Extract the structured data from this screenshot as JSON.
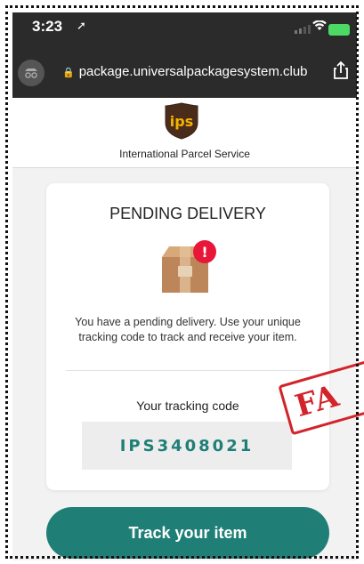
{
  "status_bar": {
    "time": "3:23",
    "location_arrow": "➚",
    "wifi_icon": "wifi-icon",
    "battery_icon": "battery-charging-icon"
  },
  "browser": {
    "url": "package.universalpackagesystem.club",
    "lock_icon": "lock-icon",
    "share_icon": "share-icon",
    "incognito_icon": "incognito-icon"
  },
  "header": {
    "logo_text": "ips",
    "brand_name": "International Parcel Service"
  },
  "card": {
    "title": "PENDING DELIVERY",
    "alert_badge": "!",
    "description": "You have a pending delivery. Use your unique tracking code to track and receive your item.",
    "code_label": "Your tracking code",
    "tracking_code": "IPS3408021"
  },
  "cta": {
    "label": "Track your item"
  },
  "overlay": {
    "stamp_text": "FA"
  },
  "colors": {
    "primary": "#1f7f77",
    "badge": "#e8173a",
    "stamp": "#d2242a",
    "logo_brown": "#4a2c1b",
    "logo_gold": "#f4b400"
  }
}
